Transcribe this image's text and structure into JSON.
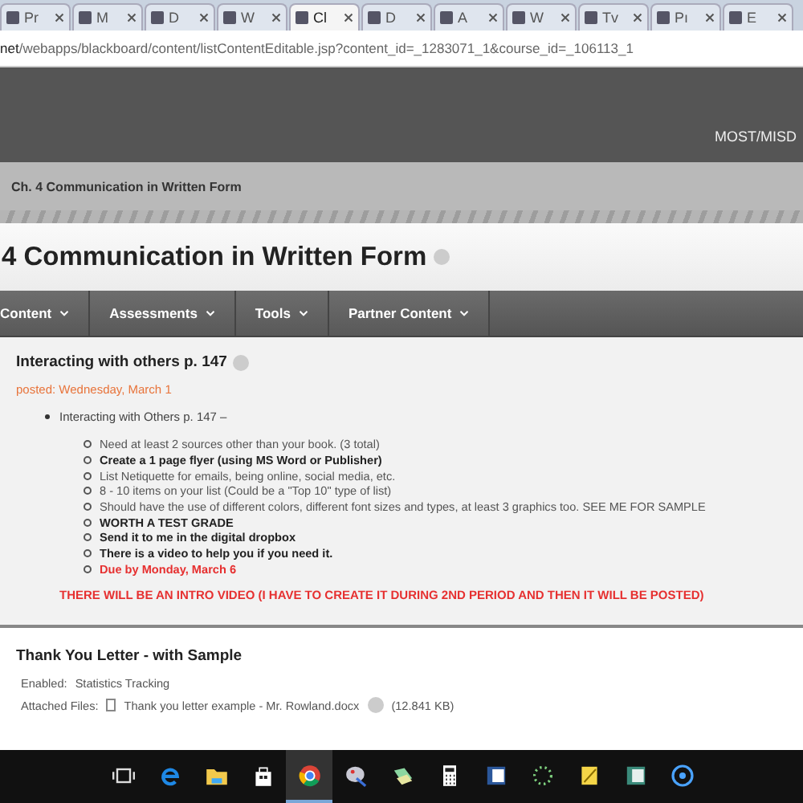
{
  "browser": {
    "tabs": [
      {
        "label": "Pr",
        "selected": false
      },
      {
        "label": "M",
        "selected": false
      },
      {
        "label": "D",
        "selected": false
      },
      {
        "label": "W",
        "selected": false
      },
      {
        "label": "Cl",
        "selected": true
      },
      {
        "label": "D",
        "selected": false
      },
      {
        "label": "A",
        "selected": false
      },
      {
        "label": "W",
        "selected": false
      },
      {
        "label": "Tv",
        "selected": false
      },
      {
        "label": "Pı",
        "selected": false
      },
      {
        "label": "E",
        "selected": false
      }
    ],
    "url_host": "net",
    "url_path": "/webapps/blackboard/content/listContentEditable.jsp?content_id=_1283071_1&course_id=_106113_1"
  },
  "header": {
    "user": "MOST/MISD"
  },
  "breadcrumb": "Ch. 4 Communication in Written Form",
  "page_title": "4 Communication in Written Form",
  "nav": [
    "Content",
    "Assessments",
    "Tools",
    "Partner Content"
  ],
  "items": [
    {
      "title": "Interacting with others p. 147",
      "posted": "posted: Wednesday, March 1",
      "bullet": "Interacting with Others p. 147 –",
      "subitems": [
        {
          "text": "Need at least 2 sources other than your book. (3 total)",
          "kind": "plain"
        },
        {
          "text": "Create a 1 page flyer (using MS Word or Publisher)",
          "kind": "bold"
        },
        {
          "text": "List Netiquette for emails, being online, social media, etc.",
          "kind": "plain"
        },
        {
          "text": "8 - 10 items on your list (Could be a \"Top 10\" type of list)",
          "kind": "plain"
        },
        {
          "text": "Should have the use of different colors, different font sizes and types, at least 3 graphics too. SEE ME FOR SAMPLE",
          "kind": "plain"
        },
        {
          "text": "WORTH A TEST GRADE",
          "kind": "bold"
        },
        {
          "text": "Send it to me in the digital dropbox",
          "kind": "bold"
        },
        {
          "text": "There is a video to help you if you need it.",
          "kind": "bold"
        },
        {
          "text": "Due by Monday, March 6",
          "kind": "alert"
        }
      ],
      "notice": "THERE WILL BE AN INTRO VIDEO (I HAVE TO CREATE IT DURING 2ND PERIOD AND THEN IT WILL BE POSTED)"
    },
    {
      "title": "Thank You Letter - with Sample",
      "enabled_label": "Enabled:",
      "enabled_value": "Statistics Tracking",
      "files_label": "Attached Files:",
      "file_name": "Thank you letter example - Mr. Rowland.docx",
      "file_size": "(12.841 KB)"
    }
  ],
  "taskbar": [
    {
      "kind": "taskview",
      "selected": false
    },
    {
      "kind": "edge",
      "selected": false
    },
    {
      "kind": "folder",
      "selected": false
    },
    {
      "kind": "store",
      "selected": false
    },
    {
      "kind": "chrome",
      "selected": true
    },
    {
      "kind": "paint",
      "selected": false
    },
    {
      "kind": "notes",
      "selected": false
    },
    {
      "kind": "calculator",
      "selected": false
    },
    {
      "kind": "word",
      "selected": false
    },
    {
      "kind": "loader",
      "selected": false
    },
    {
      "kind": "sticky",
      "selected": false
    },
    {
      "kind": "publisher",
      "selected": false
    },
    {
      "kind": "cortana",
      "selected": false
    }
  ]
}
